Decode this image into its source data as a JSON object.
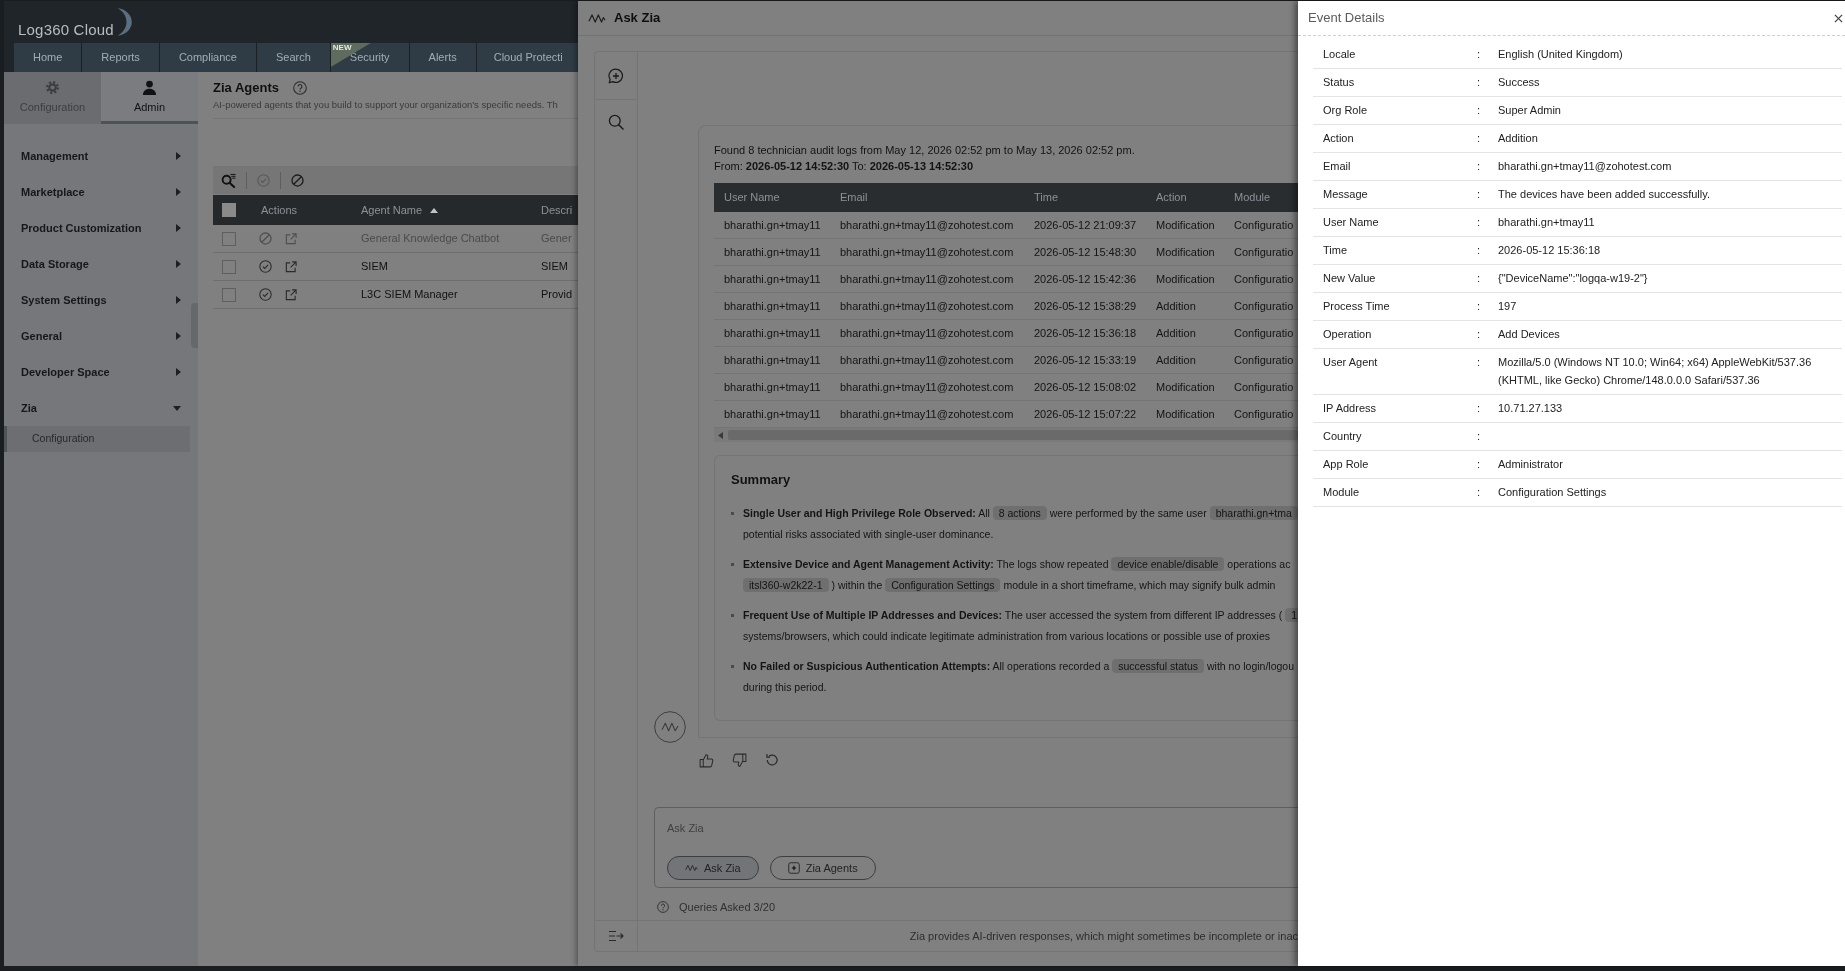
{
  "header": {
    "logo": "Log360 Cloud",
    "tabs": [
      {
        "label": "Home",
        "selected": false
      },
      {
        "label": "Reports",
        "selected": false
      },
      {
        "label": "Compliance",
        "selected": false
      },
      {
        "label": "Search",
        "selected": false
      },
      {
        "label": "Security",
        "selected": false,
        "badge": "NEW"
      },
      {
        "label": "Alerts",
        "selected": false
      },
      {
        "label": "Cloud Protecti",
        "selected": false
      }
    ]
  },
  "sidebar": {
    "tabs": [
      {
        "label": "Configuration",
        "selected": false
      },
      {
        "label": "Admin",
        "selected": true
      }
    ],
    "items": [
      {
        "label": "Management",
        "expanded": false
      },
      {
        "label": "Marketplace",
        "expanded": false
      },
      {
        "label": "Product Customization",
        "expanded": false
      },
      {
        "label": "Data Storage",
        "expanded": false
      },
      {
        "label": "System Settings",
        "expanded": false
      },
      {
        "label": "General",
        "expanded": false
      },
      {
        "label": "Developer Space",
        "expanded": false
      },
      {
        "label": "Zia",
        "expanded": true,
        "children": [
          {
            "label": "Configuration",
            "selected": true
          }
        ]
      }
    ]
  },
  "page": {
    "title": "Zia Agents",
    "subtitle": "AI-powered agents that you build to support your organization's specific needs. Th",
    "agents_table": {
      "select_all": {
        "checked": false
      },
      "columns": [
        {
          "label": "Actions",
          "sorted": false
        },
        {
          "label": "Agent Name",
          "sorted": true
        },
        {
          "label": "Descri",
          "sorted": false
        }
      ],
      "rows": [
        {
          "checked": false,
          "enabled": false,
          "name": "General Knowledge Chatbot",
          "description": "Gener"
        },
        {
          "checked": false,
          "enabled": true,
          "name": "SIEM",
          "description": "SIEM"
        },
        {
          "checked": false,
          "enabled": true,
          "name": "L3C SIEM Manager",
          "description": "Provid"
        }
      ]
    }
  },
  "ask_zia": {
    "title": "Ask Zia",
    "message": {
      "intro": "Found 8 technician audit logs from May 12, 2026 02:52 pm to May 13, 2026 02:52 pm.",
      "range": "From: **2026-05-12 14:52:30** To: **2026-05-13 14:52:30**",
      "table": {
        "columns": [
          "User Name",
          "Email",
          "Time",
          "Action",
          "Module"
        ],
        "rows": [
          [
            "bharathi.gn+tmay11",
            "bharathi.gn+tmay11@zohotest.com",
            "2026-05-12 21:09:37",
            "Modification",
            "Configuratio"
          ],
          [
            "bharathi.gn+tmay11",
            "bharathi.gn+tmay11@zohotest.com",
            "2026-05-12 15:48:30",
            "Modification",
            "Configuratio"
          ],
          [
            "bharathi.gn+tmay11",
            "bharathi.gn+tmay11@zohotest.com",
            "2026-05-12 15:42:36",
            "Modification",
            "Configuratio"
          ],
          [
            "bharathi.gn+tmay11",
            "bharathi.gn+tmay11@zohotest.com",
            "2026-05-12 15:38:29",
            "Addition",
            "Configuratio"
          ],
          [
            "bharathi.gn+tmay11",
            "bharathi.gn+tmay11@zohotest.com",
            "2026-05-12 15:36:18",
            "Addition",
            "Configuratio"
          ],
          [
            "bharathi.gn+tmay11",
            "bharathi.gn+tmay11@zohotest.com",
            "2026-05-12 15:33:19",
            "Addition",
            "Configuratio"
          ],
          [
            "bharathi.gn+tmay11",
            "bharathi.gn+tmay11@zohotest.com",
            "2026-05-12 15:08:02",
            "Modification",
            "Configuratio"
          ],
          [
            "bharathi.gn+tmay11",
            "bharathi.gn+tmay11@zohotest.com",
            "2026-05-12 15:07:22",
            "Modification",
            "Configuratio"
          ]
        ]
      },
      "summary": {
        "title": "Summary",
        "points": [
          {
            "lines": [
              [
                {
                  "kind": "text",
                  "text": "**Single User and High Privilege Role Observed:** All "
                },
                {
                  "kind": "chip",
                  "text": "8 actions"
                },
                {
                  "kind": "text",
                  "text": " were performed by the same user "
                },
                {
                  "kind": "chip",
                  "text": "bharathi.gn+tma"
                }
              ],
              [
                {
                  "kind": "text",
                  "text": "potential risks associated with single-user dominance."
                }
              ]
            ]
          },
          {
            "lines": [
              [
                {
                  "kind": "text",
                  "text": "**Extensive Device and Agent Management Activity:** The logs show repeated "
                },
                {
                  "kind": "chip",
                  "text": "device enable/disable"
                },
                {
                  "kind": "text",
                  "text": " operations ac"
                }
              ],
              [
                {
                  "kind": "chip",
                  "text": "itsl360-w2k22-1"
                },
                {
                  "kind": "text",
                  "text": " ) within the "
                },
                {
                  "kind": "chip",
                  "text": "Configuration Settings"
                },
                {
                  "kind": "text",
                  "text": " module in a short timeframe, which may signify bulk admin"
                }
              ]
            ]
          },
          {
            "lines": [
              [
                {
                  "kind": "text",
                  "text": "**Frequent Use of Multiple IP Addresses and Devices:** The user accessed the system from different IP addresses ( "
                },
                {
                  "kind": "chip",
                  "text": "1"
                }
              ],
              [
                {
                  "kind": "text",
                  "text": "systems/browsers, which could indicate legitimate administration from various locations or possible use of proxies"
                }
              ]
            ]
          },
          {
            "lines": [
              [
                {
                  "kind": "text",
                  "text": "**No Failed or Suspicious Authentication Attempts:** All operations recorded a "
                },
                {
                  "kind": "chip",
                  "text": "successful status"
                },
                {
                  "kind": "text",
                  "text": " with no login/logou"
                }
              ],
              [
                {
                  "kind": "text",
                  "text": "during this period."
                }
              ]
            ]
          }
        ]
      }
    },
    "input": {
      "placeholder": "Ask Zia"
    },
    "modes": [
      {
        "label": "Ask Zia",
        "selected": true
      },
      {
        "label": "Zia Agents",
        "selected": false
      }
    ],
    "queries": "Queries Asked 3/20",
    "disclaimer": "Zia provides AI-driven responses, which might sometimes be incomplete or inac"
  },
  "event_details": {
    "title": "Event Details",
    "fields": [
      {
        "label": "Locale",
        "sep": ":",
        "value": "English (United Kingdom)"
      },
      {
        "label": "Status",
        "sep": ":",
        "value": "Success"
      },
      {
        "label": "Org Role",
        "sep": ":",
        "value": "Super Admin"
      },
      {
        "label": "Action",
        "sep": ":",
        "value": "Addition"
      },
      {
        "label": "Email",
        "sep": ":",
        "value": "bharathi.gn+tmay11@zohotest.com"
      },
      {
        "label": "Message",
        "sep": ":",
        "value": "The devices have been added successfully."
      },
      {
        "label": "User Name",
        "sep": ":",
        "value": "bharathi.gn+tmay11"
      },
      {
        "label": "Time",
        "sep": ":",
        "value": "2026-05-12 15:36:18"
      },
      {
        "label": "New Value",
        "sep": ":",
        "value": "{\"DeviceName\":\"logqa-w19-2\"}"
      },
      {
        "label": "Process Time",
        "sep": ":",
        "value": "197"
      },
      {
        "label": "Operation",
        "sep": ":",
        "value": "Add Devices"
      },
      {
        "label": "User Agent",
        "sep": ":",
        "value": "Mozilla/5.0 (Windows NT 10.0; Win64; x64) AppleWebKit/537.36 (KHTML, like Gecko) Chrome/148.0.0.0 Safari/537.36"
      },
      {
        "label": "IP Address",
        "sep": ":",
        "value": "10.71.27.133"
      },
      {
        "label": "Country",
        "sep": ":"
      },
      {
        "label": "App Role",
        "sep": ":",
        "value": "Administrator"
      },
      {
        "label": "Module",
        "sep": ":",
        "value": "Configuration Settings"
      }
    ]
  }
}
